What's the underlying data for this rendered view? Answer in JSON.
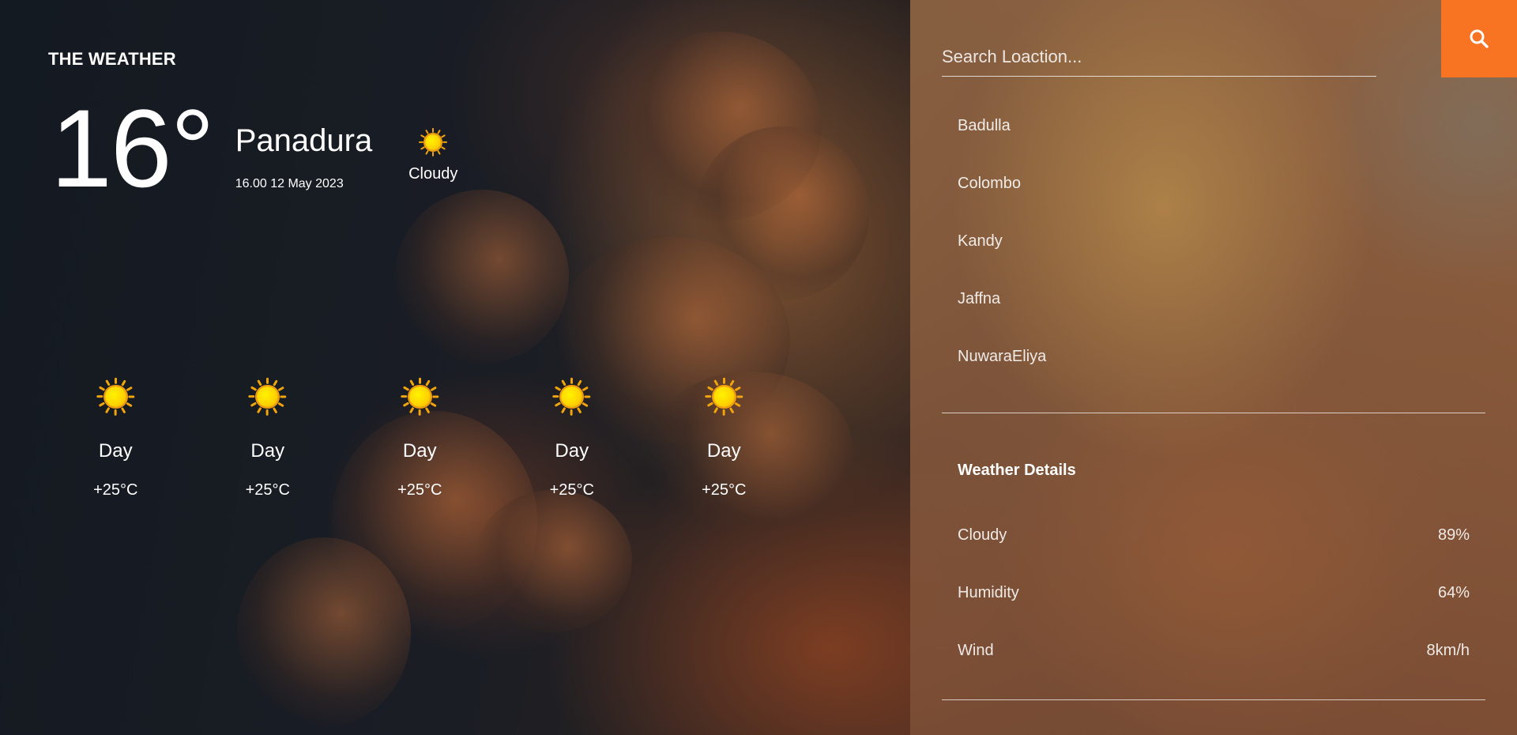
{
  "brand": "THE WEATHER",
  "current": {
    "temperature": "16°",
    "city": "Panadura",
    "datetime": "16.00 12 May 2023",
    "condition": "Cloudy",
    "icon": "sun-icon"
  },
  "forecast": [
    {
      "label": "Day",
      "temp": "+25°C",
      "icon": "sun-icon"
    },
    {
      "label": "Day",
      "temp": "+25°C",
      "icon": "sun-icon"
    },
    {
      "label": "Day",
      "temp": "+25°C",
      "icon": "sun-icon"
    },
    {
      "label": "Day",
      "temp": "+25°C",
      "icon": "sun-icon"
    },
    {
      "label": "Day",
      "temp": "+25°C",
      "icon": "sun-icon"
    }
  ],
  "search": {
    "placeholder": "Search Loaction...",
    "value": "",
    "button_icon": "search-icon",
    "button_color": "#f97422"
  },
  "locations": [
    "Badulla",
    "Colombo",
    "Kandy",
    "Jaffna",
    "NuwaraEliya"
  ],
  "details": {
    "title": "Weather Details",
    "rows": [
      {
        "label": "Cloudy",
        "value": "89%"
      },
      {
        "label": "Humidity",
        "value": "64%"
      },
      {
        "label": "Wind",
        "value": "8km/h"
      }
    ]
  }
}
